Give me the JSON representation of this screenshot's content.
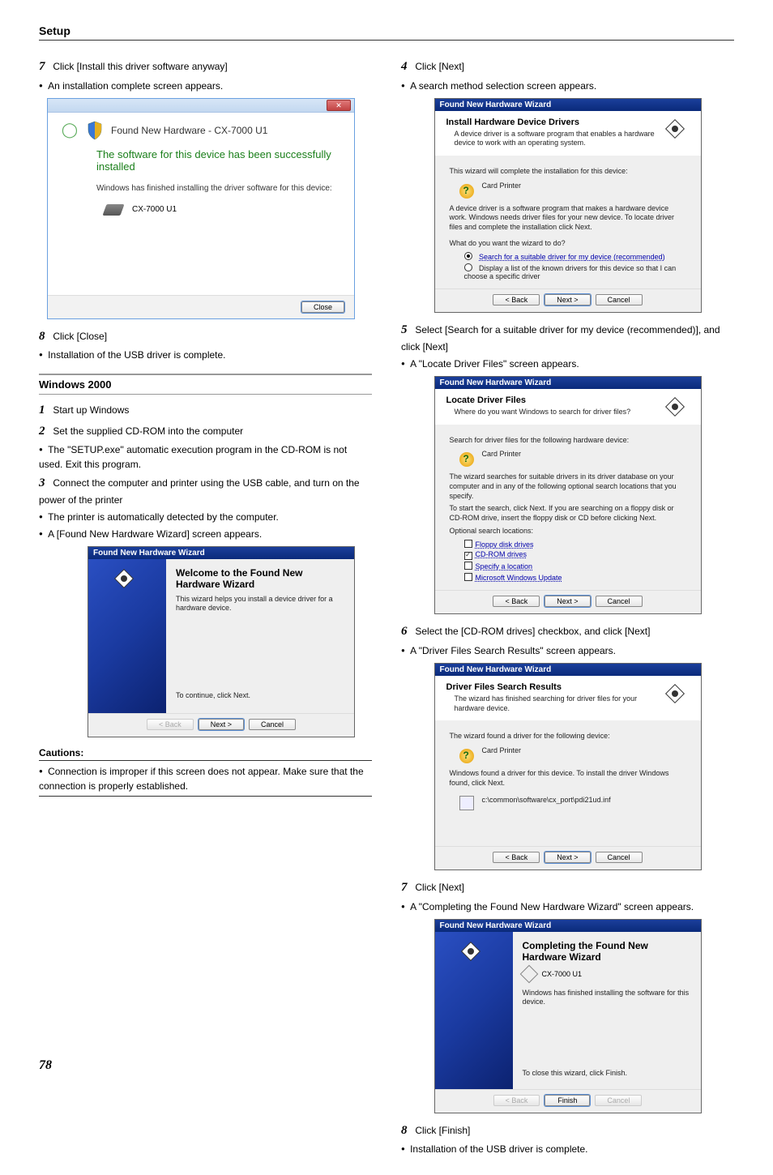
{
  "page": {
    "header": "Setup",
    "number": "78"
  },
  "left": {
    "s7": {
      "num": "7",
      "text": "Click [Install this driver software anyway]"
    },
    "b7": "An installation complete screen appears.",
    "vista": {
      "window_title": "Found New Hardware - CX-7000 U1",
      "success": "The software for this device has been successfully installed",
      "line": "Windows has finished installing the driver software for this device:",
      "device": "CX-7000 U1",
      "close": "Close"
    },
    "s8": {
      "num": "8",
      "text": "Click [Close]"
    },
    "b8": "Installation of the USB driver is complete.",
    "sectionTitle": "Windows 2000",
    "w1": {
      "num": "1",
      "text": "Start up Windows"
    },
    "w2": {
      "num": "2",
      "text": "Set the supplied CD-ROM into the computer"
    },
    "w2b": "The \"SETUP.exe\" automatic execution program in the CD-ROM is not used. Exit this program.",
    "w3": {
      "num": "3",
      "text": "Connect the computer and printer using the USB cable, and turn on the power of the printer"
    },
    "w3b1": "The printer is automatically detected by the computer.",
    "w3b2": "A [Found New Hardware Wizard] screen appears.",
    "wiz_welcome": {
      "title_bar": "Found New Hardware Wizard",
      "h": "Welcome to the Found New Hardware Wizard",
      "p": "This wizard helps you install a device driver for a hardware device.",
      "cont": "To continue, click Next.",
      "back": "< Back",
      "next": "Next >",
      "cancel": "Cancel"
    },
    "cautions_head": "Cautions:",
    "caution1": "Connection is improper if this screen does not appear. Make sure that the connection is properly established."
  },
  "right": {
    "s4": {
      "num": "4",
      "text": "Click [Next]"
    },
    "b4": "A search method selection screen appears.",
    "dlg4": {
      "title_bar": "Found New Hardware Wizard",
      "h": "Install Hardware Device Drivers",
      "hp": "A device driver is a software program that enables a hardware device to work with an operating system.",
      "l1": "This wizard will complete the installation for this device:",
      "dev": "Card Printer",
      "l2": "A device driver is a software program that makes a hardware device work. Windows needs driver files for your new device. To locate driver files and complete the installation click Next.",
      "q": "What do you want the wizard to do?",
      "opt1": "Search for a suitable driver for my device (recommended)",
      "opt2": "Display a list of the known drivers for this device so that I can choose a specific driver",
      "back": "< Back",
      "next": "Next >",
      "cancel": "Cancel"
    },
    "s5": {
      "num": "5",
      "text": "Select [Search for a suitable driver for my device (recommended)], and click [Next]"
    },
    "b5": "A \"Locate Driver Files\" screen appears.",
    "dlg5": {
      "title_bar": "Found New Hardware Wizard",
      "h": "Locate Driver Files",
      "hp": "Where do you want Windows to search for driver files?",
      "l1": "Search for driver files for the following hardware device:",
      "dev": "Card Printer",
      "l2": "The wizard searches for suitable drivers in its driver database on your computer and in any of the following optional search locations that you specify.",
      "l3": "To start the search, click Next. If you are searching on a floppy disk or CD-ROM drive, insert the floppy disk or CD before clicking Next.",
      "optH": "Optional search locations:",
      "c1": "Floppy disk drives",
      "c2": "CD-ROM drives",
      "c3": "Specify a location",
      "c4": "Microsoft Windows Update",
      "back": "< Back",
      "next": "Next >",
      "cancel": "Cancel"
    },
    "s6": {
      "num": "6",
      "text": "Select the [CD-ROM drives] checkbox, and click [Next]"
    },
    "b6": "A \"Driver Files Search Results\" screen appears.",
    "dlg6": {
      "title_bar": "Found New Hardware Wizard",
      "h": "Driver Files Search Results",
      "hp": "The wizard has finished searching for driver files for your hardware device.",
      "l1": "The wizard found a driver for the following device:",
      "dev": "Card Printer",
      "l2": "Windows found a driver for this device. To install the driver Windows found, click Next.",
      "path": "c:\\common\\software\\cx_port\\pdi21ud.inf",
      "back": "< Back",
      "next": "Next >",
      "cancel": "Cancel"
    },
    "s7": {
      "num": "7",
      "text": "Click [Next]"
    },
    "b7": "A \"Completing the Found New Hardware Wizard\" screen appears.",
    "dlg7": {
      "title_bar": "Found New Hardware Wizard",
      "h": "Completing the Found New Hardware Wizard",
      "dev": "CX-7000 U1",
      "l1": "Windows has finished installing the software for this device.",
      "close": "To close this wizard, click Finish.",
      "back": "< Back",
      "finish": "Finish",
      "cancel": "Cancel"
    },
    "s8": {
      "num": "8",
      "text": "Click [Finish]"
    },
    "b8": "Installation of the USB driver is complete."
  }
}
